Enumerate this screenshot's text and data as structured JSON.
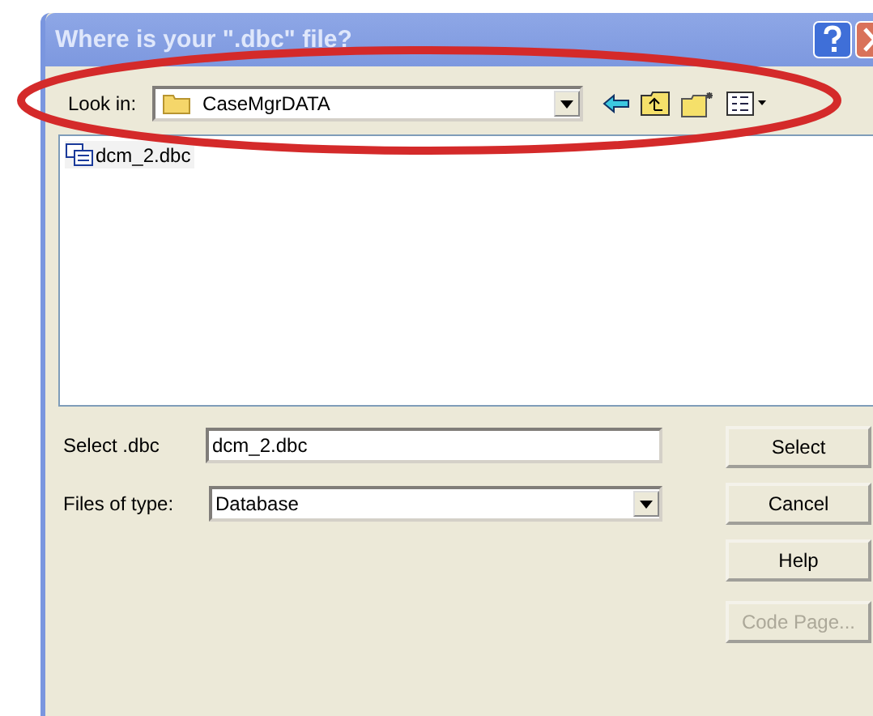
{
  "window": {
    "title": "Where is your \".dbc\" file?"
  },
  "look_in": {
    "label": "Look in:",
    "value": "CaseMgrDATA"
  },
  "files": [
    {
      "name": "dcm_2.dbc"
    }
  ],
  "fields": [
    {
      "label": "Select .dbc",
      "value": "dcm_2.dbc",
      "kind": "text"
    },
    {
      "label": "Files of type:",
      "value": "Database",
      "kind": "combo"
    }
  ],
  "buttons": [
    {
      "label": "Select",
      "disabled": false
    },
    {
      "label": "Cancel",
      "disabled": false
    },
    {
      "label": "Help",
      "disabled": false
    },
    {
      "label": "Code Page...",
      "disabled": true
    }
  ],
  "annotation": {
    "kind": "ellipse"
  }
}
